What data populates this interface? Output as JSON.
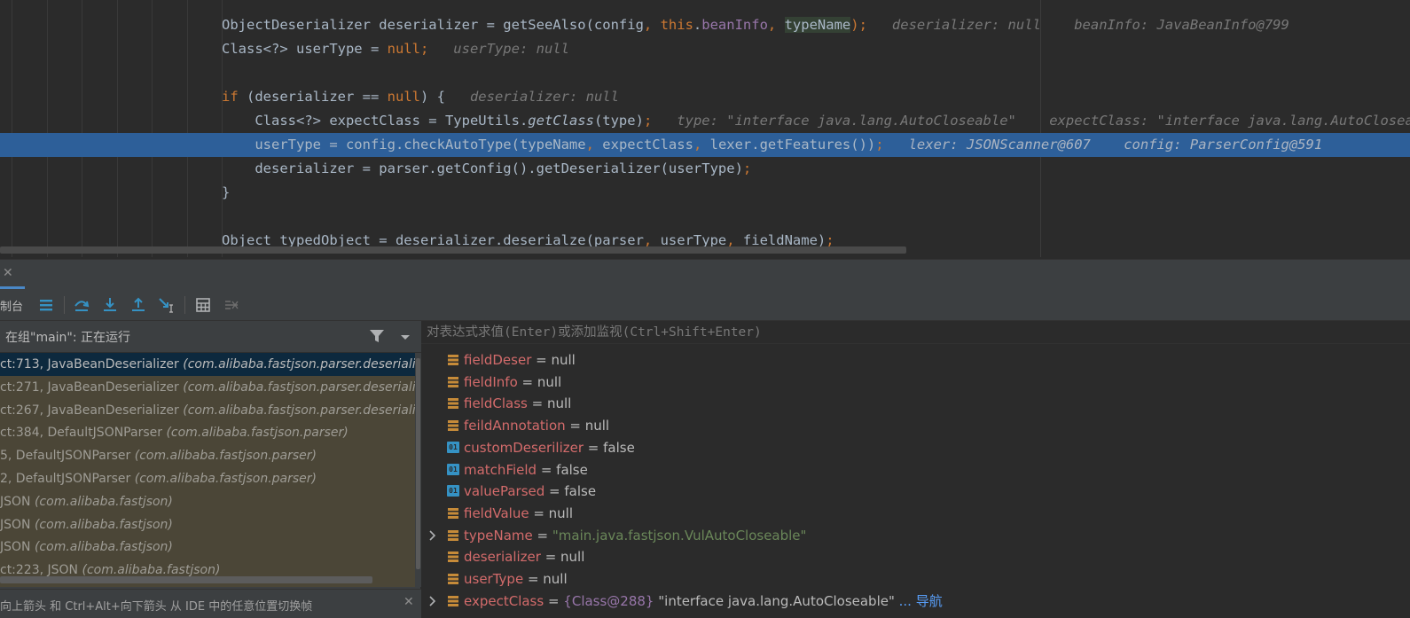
{
  "editor": {
    "lines": [
      {
        "segments": [
          {
            "text": "ObjectDeserializer deserializer = getSeeAlso(config",
            "cls": ""
          },
          {
            "text": ", ",
            "cls": "kw"
          },
          {
            "text": "this",
            "cls": "kw"
          },
          {
            "text": ".",
            "cls": ""
          },
          {
            "text": "beanInfo",
            "cls": "fld"
          },
          {
            "text": ", ",
            "cls": "kw"
          },
          {
            "text": "typeName",
            "cls": "sel"
          },
          {
            "text": ");",
            "cls": "kw"
          },
          {
            "text": "   deserializer: null    beanInfo: JavaBeanInfo@799",
            "cls": "inl"
          }
        ]
      },
      {
        "segments": [
          {
            "text": "Class<?> userType = ",
            "cls": ""
          },
          {
            "text": "null;",
            "cls": "kw"
          },
          {
            "text": "   userType: null",
            "cls": "inl"
          }
        ]
      },
      {
        "segments": []
      },
      {
        "segments": [
          {
            "text": "if",
            "cls": "kw"
          },
          {
            "text": " (deserializer == ",
            "cls": ""
          },
          {
            "text": "null",
            "cls": "kw"
          },
          {
            "text": ") {",
            "cls": ""
          },
          {
            "text": "   deserializer: null",
            "cls": "inl"
          }
        ]
      },
      {
        "segments": [
          {
            "text": "    Class<?> expectClass = TypeUtils.",
            "cls": ""
          },
          {
            "text": "getClass",
            "cls": "it"
          },
          {
            "text": "(type)",
            "cls": ""
          },
          {
            "text": ";",
            "cls": "kw"
          },
          {
            "text": "   type: \"interface java.lang.AutoCloseable\"    expectClass: \"interface java.lang.AutoCloseable\"",
            "cls": "inl"
          }
        ]
      },
      {
        "segments": [
          {
            "text": "    userType = config.checkAutoType(typeName",
            "cls": ""
          },
          {
            "text": ", ",
            "cls": "kw"
          },
          {
            "text": "expectClass",
            "cls": ""
          },
          {
            "text": ", ",
            "cls": "kw"
          },
          {
            "text": "lexer.getFeatures())",
            "cls": ""
          },
          {
            "text": ";",
            "cls": "kw"
          },
          {
            "text": "   lexer: JSONScanner@607    config: ParserConfig@591",
            "cls": "inl"
          }
        ]
      },
      {
        "segments": [
          {
            "text": "    deserializer = parser.getConfig().getDeserializer(userType)",
            "cls": ""
          },
          {
            "text": ";",
            "cls": "kw"
          }
        ]
      },
      {
        "segments": [
          {
            "text": "}",
            "cls": ""
          }
        ]
      },
      {
        "segments": []
      },
      {
        "segments": [
          {
            "text": "Object typedObject = deserializer.deserialze(parser",
            "cls": ""
          },
          {
            "text": ", ",
            "cls": "kw"
          },
          {
            "text": "userType",
            "cls": ""
          },
          {
            "text": ", ",
            "cls": "kw"
          },
          {
            "text": "fieldName)",
            "cls": ""
          },
          {
            "text": ";",
            "cls": "kw"
          }
        ]
      }
    ]
  },
  "debug": {
    "console_tab_label": "制台",
    "thread_label": "在组\"main\": 正在运行",
    "frames": [
      {
        "loc": "ct:713, JavaBeanDeserializer ",
        "pkg": "(com.alibaba.fastjson.parser.deserializer)"
      },
      {
        "loc": "ct:271, JavaBeanDeserializer ",
        "pkg": "(com.alibaba.fastjson.parser.deserializer)"
      },
      {
        "loc": "ct:267, JavaBeanDeserializer ",
        "pkg": "(com.alibaba.fastjson.parser.deserializer)"
      },
      {
        "loc": "ct:384, DefaultJSONParser ",
        "pkg": "(com.alibaba.fastjson.parser)"
      },
      {
        "loc": "5, DefaultJSONParser ",
        "pkg": "(com.alibaba.fastjson.parser)"
      },
      {
        "loc": "2, DefaultJSONParser ",
        "pkg": "(com.alibaba.fastjson.parser)"
      },
      {
        "loc": " JSON ",
        "pkg": "(com.alibaba.fastjson)"
      },
      {
        "loc": " JSON ",
        "pkg": "(com.alibaba.fastjson)"
      },
      {
        "loc": " JSON ",
        "pkg": "(com.alibaba.fastjson)"
      },
      {
        "loc": "ct:223, JSON ",
        "pkg": "(com.alibaba.fastjson)"
      }
    ],
    "hint_text": "向上箭头 和 Ctrl+Alt+向下箭头 从 IDE 中的任意位置切换帧",
    "eval_placeholder": "对表达式求值(Enter)或添加监视(Ctrl+Shift+Enter)",
    "variables": [
      {
        "name": "fieldDeser",
        "value": "null",
        "vtype": "null",
        "icon": "field-icon",
        "expandable": false
      },
      {
        "name": "fieldInfo",
        "value": "null",
        "vtype": "null",
        "icon": "field-icon",
        "expandable": false
      },
      {
        "name": "fieldClass",
        "value": "null",
        "vtype": "null",
        "icon": "field-icon",
        "expandable": false
      },
      {
        "name": "feildAnnotation",
        "value": "null",
        "vtype": "null",
        "icon": "field-icon",
        "expandable": false
      },
      {
        "name": "customDeserilizer",
        "value": "false",
        "vtype": "bool",
        "icon": "boolean-icon",
        "expandable": false
      },
      {
        "name": "matchField",
        "value": "false",
        "vtype": "bool",
        "icon": "boolean-icon",
        "expandable": false
      },
      {
        "name": "valueParsed",
        "value": "false",
        "vtype": "bool",
        "icon": "boolean-icon",
        "expandable": false
      },
      {
        "name": "fieldValue",
        "value": "null",
        "vtype": "null",
        "icon": "field-icon",
        "expandable": false
      },
      {
        "name": "typeName",
        "value": "\"main.java.fastjson.VulAutoCloseable\"",
        "vtype": "str",
        "icon": "field-icon",
        "expandable": true
      },
      {
        "name": "deserializer",
        "value": "null",
        "vtype": "null",
        "icon": "field-icon",
        "expandable": false
      },
      {
        "name": "userType",
        "value": "null",
        "vtype": "null",
        "icon": "field-icon",
        "expandable": false
      },
      {
        "name": "expectClass",
        "ref": "{Class@288}",
        "value": " \"interface java.lang.AutoCloseable\"",
        "link": " ... 导航",
        "vtype": "ref",
        "icon": "field-icon",
        "expandable": true
      }
    ]
  },
  "colors": {
    "editor_bg": "#2b2b2b",
    "exec_line": "#2d5f99",
    "keyword": "#cc7832",
    "field": "#9876aa",
    "string": "#6a8759",
    "var_name": "#d36b6b",
    "frames_bg": "#4b4637",
    "current_frame": "#0d293e"
  }
}
